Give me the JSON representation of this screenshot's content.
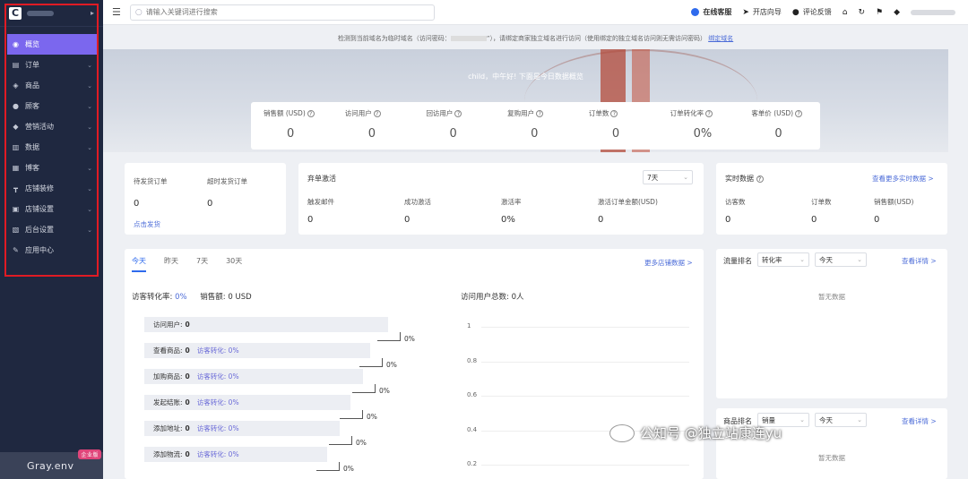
{
  "sidebar": {
    "logo": "C",
    "menu": [
      {
        "label": "概览",
        "icon": "dashboard-icon",
        "glyph": "◉",
        "active": true
      },
      {
        "label": "订单",
        "icon": "order-icon",
        "glyph": "▤",
        "active": false
      },
      {
        "label": "商品",
        "icon": "product-icon",
        "glyph": "◈",
        "active": false
      },
      {
        "label": "顾客",
        "icon": "customer-icon",
        "glyph": "●",
        "active": false
      },
      {
        "label": "营销活动",
        "icon": "tag-icon",
        "glyph": "◆",
        "active": false
      },
      {
        "label": "数据",
        "icon": "bar-chart-icon",
        "glyph": "▥",
        "active": false
      },
      {
        "label": "博客",
        "icon": "blog-icon",
        "glyph": "▦",
        "active": false
      },
      {
        "label": "店铺装修",
        "icon": "paint-roller-icon",
        "glyph": "┳",
        "active": false
      },
      {
        "label": "店铺设置",
        "icon": "store-icon",
        "glyph": "▣",
        "active": false
      },
      {
        "label": "后台设置",
        "icon": "settings-icon",
        "glyph": "▧",
        "active": false
      },
      {
        "label": "应用中心",
        "icon": "wrench-icon",
        "glyph": "✎",
        "active": false
      }
    ],
    "brand": "Gray.env",
    "badge": "企业版"
  },
  "topbar": {
    "search_placeholder": "请输入关键词进行搜索",
    "online_service": "在线客服",
    "store_guide": "开店向导",
    "feedback": "评论反馈"
  },
  "notice": {
    "text_before": "检测到当前域名为临时域名（访问密码：",
    "text_after": "”），请绑定商家独立域名进行访问（使用绑定的独立域名访问则无需访问密码）",
    "link": "绑定域名"
  },
  "hero": {
    "greeting": "child，中午好! 下面是今日数据概览"
  },
  "kpis": [
    {
      "label": "销售额 (USD)",
      "value": "0"
    },
    {
      "label": "访问用户",
      "value": "0"
    },
    {
      "label": "回访用户",
      "value": "0"
    },
    {
      "label": "复购用户",
      "value": "0"
    },
    {
      "label": "订单数",
      "value": "0"
    },
    {
      "label": "订单转化率",
      "value": "0%"
    },
    {
      "label": "客单价 (USD)",
      "value": "0"
    }
  ],
  "orders_card": {
    "pending_label": "待发货订单",
    "pending_value": "0",
    "overdue_label": "超时发货订单",
    "overdue_value": "0",
    "ship_link": "点击发货"
  },
  "abandon_card": {
    "title": "弃单激活",
    "range": "7天",
    "cols": [
      {
        "label": "触发邮件",
        "value": "0"
      },
      {
        "label": "成功激活",
        "value": "0"
      },
      {
        "label": "激活率",
        "value": "0%"
      },
      {
        "label": "激活订单金额(USD)",
        "value": "0"
      }
    ]
  },
  "realtime_card": {
    "title": "实时数据",
    "more": "查看更多实时数据 >",
    "cols": [
      {
        "label": "访客数",
        "value": "0"
      },
      {
        "label": "订单数",
        "value": "0"
      },
      {
        "label": "销售额(USD)",
        "value": "0"
      }
    ]
  },
  "analytics": {
    "tabs": [
      "今天",
      "昨天",
      "7天",
      "30天"
    ],
    "more": "更多店铺数据 >",
    "conv_label": "访客转化率:",
    "conv_value": "0%",
    "sales_label": "销售额:",
    "sales_value": "0 USD",
    "total_label": "访问用户总数:",
    "total_value": "0人",
    "funnel": [
      {
        "label": "访问用户:",
        "value": "0",
        "conv_label": "",
        "conv_value": ""
      },
      {
        "label": "查看商品:",
        "value": "0",
        "conv_label": "访客转化:",
        "conv_value": "0%"
      },
      {
        "label": "加购商品:",
        "value": "0",
        "conv_label": "访客转化:",
        "conv_value": "0%"
      },
      {
        "label": "发起结账:",
        "value": "0",
        "conv_label": "访客转化:",
        "conv_value": "0%"
      },
      {
        "label": "添加地址:",
        "value": "0",
        "conv_label": "访客转化:",
        "conv_value": "0%"
      },
      {
        "label": "添加物流:",
        "value": "0",
        "conv_label": "访客转化:",
        "conv_value": "0%"
      }
    ],
    "step_pcts": [
      "0%",
      "0%",
      "0%",
      "0%",
      "0%",
      "0%"
    ],
    "y_ticks": [
      "1",
      "0.8",
      "0.6",
      "0.4",
      "0.2"
    ]
  },
  "traffic_rank": {
    "title": "流量排名",
    "metric": "转化率",
    "range": "今天",
    "details": "查看详情 >",
    "empty": "暂无数据"
  },
  "product_rank": {
    "title": "商品排名",
    "metric": "销量",
    "range": "今天",
    "details": "查看详情 >",
    "empty": "暂无数据"
  },
  "watermark": "公知号 @独立站康连yu"
}
